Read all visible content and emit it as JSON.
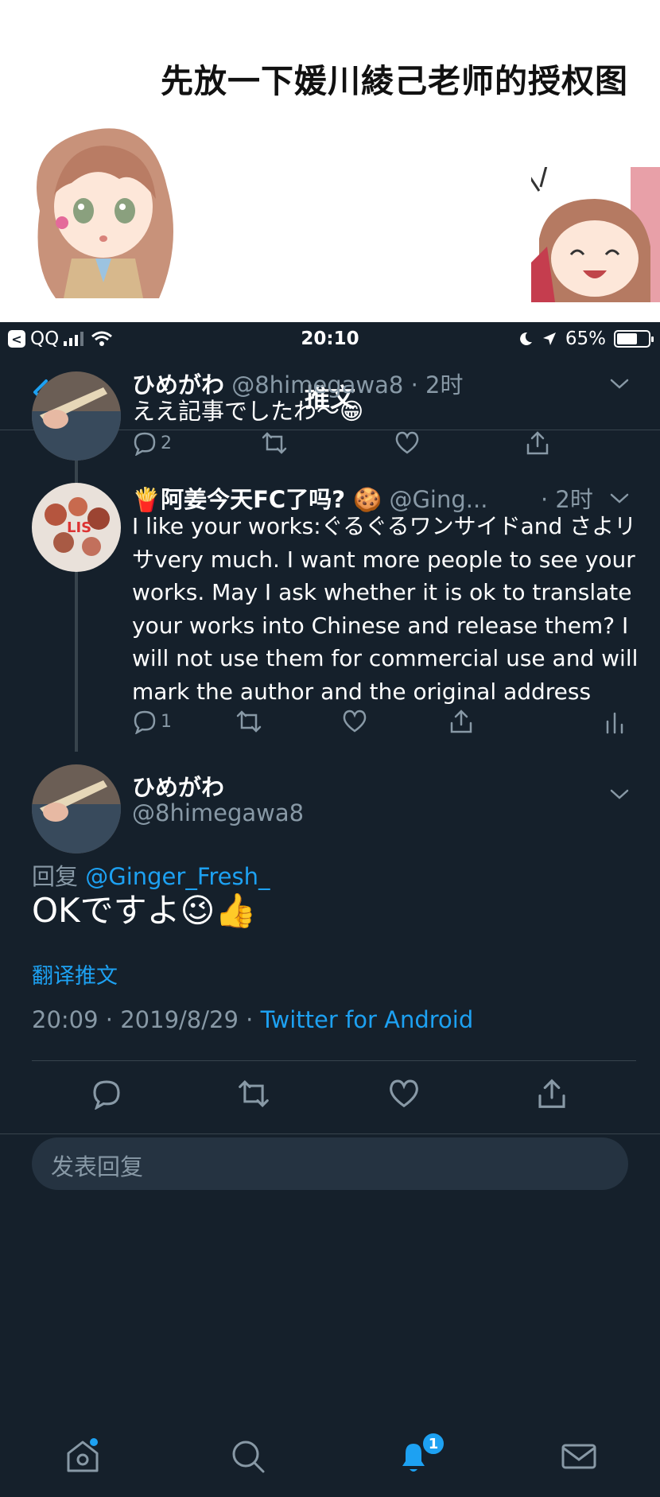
{
  "banner": {
    "title": "先放一下媛川綾己老师的授权图"
  },
  "statusbar": {
    "back_app": "QQ",
    "back_glyph": "<",
    "time": "20:10",
    "battery": "65%",
    "battery_level": 0.65
  },
  "nav": {
    "title": "推文"
  },
  "tweet1": {
    "name": "ひめがわ",
    "handle": "@8himegawa8",
    "sep": "·",
    "time": "2时",
    "text": "ええ記事でしたわ〜😁",
    "reply_count": "2"
  },
  "tweet2": {
    "name": "🍟阿姜今天FC了吗? 🍪",
    "handle": "@Ging...",
    "time": "· 2时",
    "text": "I like your works:ぐるぐるワンサイドand さよリサvery much. I want more people to see your works. May I ask whether it is ok to translate your works into Chinese and release them? I will not use them for commercial use and will mark the author and the original address",
    "reply_count": "1"
  },
  "main": {
    "name": "ひめがわ",
    "handle": "@8himegawa8",
    "reply_prefix": "回复",
    "reply_to": "@Ginger_Fresh_",
    "text": "OKですよ😉👍",
    "translate": "翻译推文",
    "datetime": "20:09 · 2019/8/29 ·",
    "source": "Twitter for Android"
  },
  "reply": {
    "placeholder": "发表回复"
  },
  "tabs": {
    "notifications_badge": "1"
  },
  "colors": {
    "background": "#15202b",
    "accent": "#1da1f2",
    "muted": "#8899a6",
    "divider": "#38444d"
  }
}
